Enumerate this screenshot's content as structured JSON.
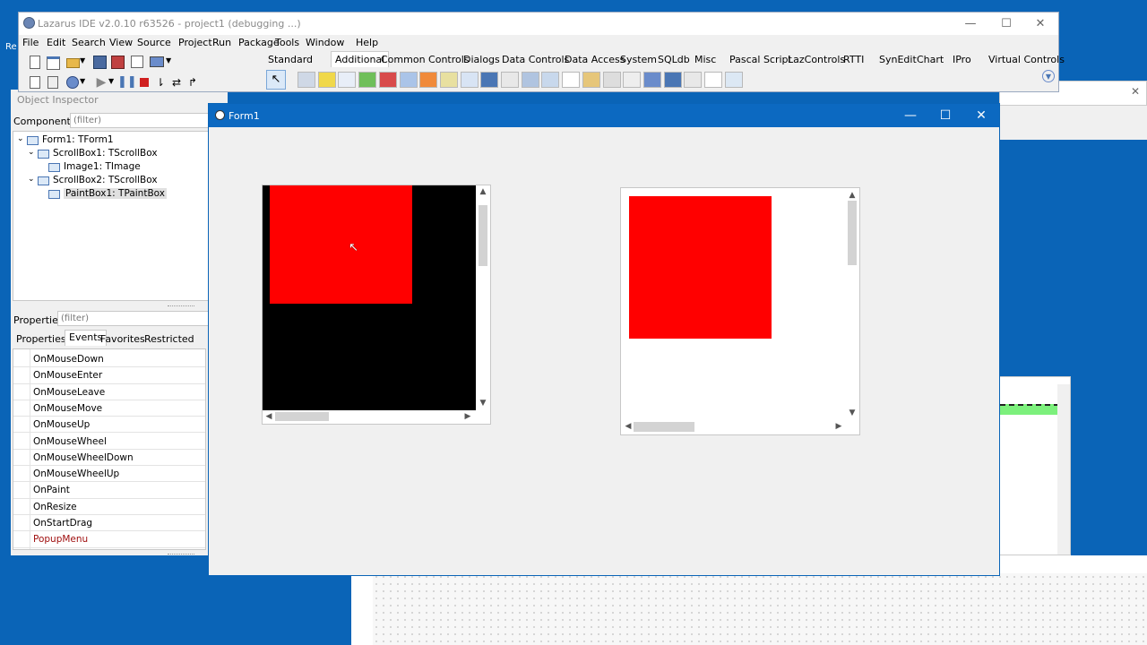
{
  "ide": {
    "title": "Lazarus IDE v2.0.10 r63526 - project1 (debugging ...)",
    "menu": [
      "File",
      "Edit",
      "Search",
      "View",
      "Source",
      "Project",
      "Run",
      "Package",
      "Tools",
      "Window",
      "Help"
    ],
    "palette_tabs": [
      "Standard",
      "Additional",
      "Common Controls",
      "Dialogs",
      "Data Controls",
      "Data Access",
      "System",
      "SQLdb",
      "Misc",
      "Pascal Script",
      "LazControls",
      "RTTI",
      "SynEdit",
      "Chart",
      "IPro",
      "Virtual Controls"
    ],
    "active_tab": "Additional",
    "side_fragment": "Re"
  },
  "inspector": {
    "title": "Object Inspector",
    "components_label": "Components",
    "filter_placeholder": "(filter)",
    "tree": [
      {
        "label": "Form1: TForm1",
        "level": 0,
        "expanded": true
      },
      {
        "label": "ScrollBox1: TScrollBox",
        "level": 1,
        "expanded": true
      },
      {
        "label": "Image1: TImage",
        "level": 2
      },
      {
        "label": "ScrollBox2: TScrollBox",
        "level": 1,
        "expanded": true
      },
      {
        "label": "PaintBox1: TPaintBox",
        "level": 2,
        "selected": true
      }
    ],
    "properties_label": "Properties",
    "props_filter_placeholder": "(filter)",
    "tabs": [
      "Properties",
      "Events",
      "Favorites",
      "Restricted"
    ],
    "active_tab": "Events",
    "events": [
      "OnMouseDown",
      "OnMouseEnter",
      "OnMouseLeave",
      "OnMouseMove",
      "OnMouseUp",
      "OnMouseWheel",
      "OnMouseWheelDown",
      "OnMouseWheelUp",
      "OnPaint",
      "OnResize",
      "OnStartDrag",
      "PopupMenu"
    ]
  },
  "form": {
    "title": "Form1"
  },
  "colors": {
    "title_blue": "#0c69c1",
    "desktop": "#0a64b7",
    "red": "#ff0000",
    "black": "#000000",
    "popup_menu": "#a01010",
    "green_bar": "#7cf07c"
  }
}
